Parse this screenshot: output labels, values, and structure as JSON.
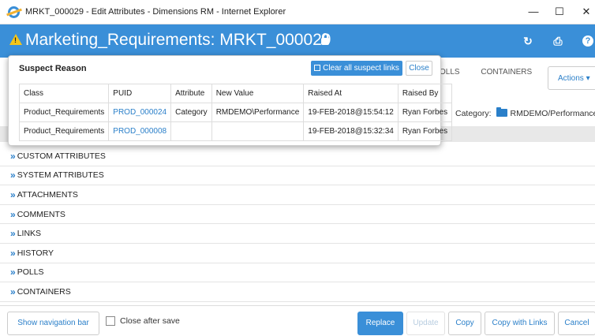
{
  "window": {
    "title": "MRKT_000029 - Edit Attributes - Dimensions RM - Internet Explorer",
    "minimize": "—",
    "maximize": "☐",
    "close": "✕"
  },
  "app": {
    "title": "Marketing_Requirements: MRKT_000029",
    "warning_glyph": "!",
    "refresh_glyph": "↻",
    "print_glyph": "⎙",
    "help_glyph": "?"
  },
  "tabs": {
    "polls_partial": "OLLS",
    "containers": "CONTAINERS"
  },
  "actions": {
    "label": "Actions ▾"
  },
  "category": {
    "label": "Category:",
    "value": "RMDEMO/Performance ▾"
  },
  "popup": {
    "title": "Suspect Reason",
    "clear_button": "Clear all suspect links",
    "close_button": "Close",
    "columns": [
      "Class",
      "PUID",
      "Attribute",
      "New Value",
      "Raised At",
      "Raised By"
    ],
    "rows": [
      [
        "Product_Requirements",
        "PROD_000024",
        "Category",
        "RMDEMO\\Performance",
        "19-FEB-2018@15:54:12",
        "Ryan Forbes"
      ],
      [
        "Product_Requirements",
        "PROD_000008",
        "",
        "",
        "19-FEB-2018@15:32:34",
        "Ryan Forbes"
      ]
    ]
  },
  "sections": [
    "CUSTOM ATTRIBUTES",
    "SYSTEM ATTRIBUTES",
    "ATTACHMENTS",
    "COMMENTS",
    "LINKS",
    "HISTORY",
    "POLLS",
    "CONTAINERS"
  ],
  "footer": {
    "show_nav": "Show navigation bar",
    "close_after_save": "Close after save",
    "replace": "Replace",
    "update": "Update",
    "copy": "Copy",
    "copy_with_links": "Copy with Links",
    "cancel": "Cancel"
  },
  "colors": {
    "accent": "#3a8fd8",
    "link": "#2a7fc9",
    "warning": "#f5c518"
  }
}
